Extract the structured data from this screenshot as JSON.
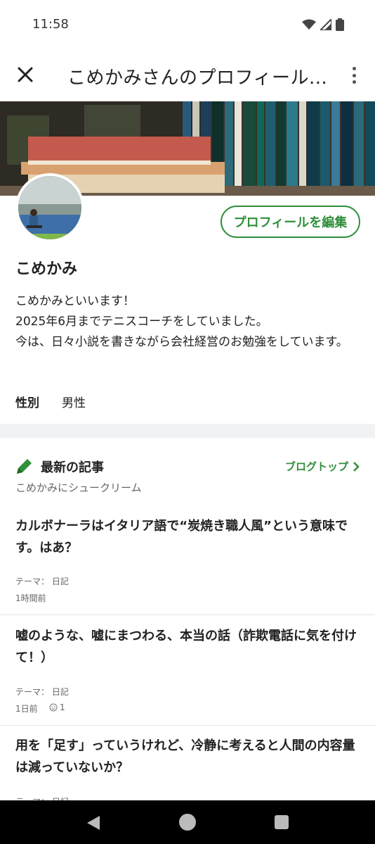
{
  "status": {
    "time": "11:58"
  },
  "header": {
    "title": "こめかみさんのプロフィール..."
  },
  "profile": {
    "edit_label": "プロフィールを編集",
    "name": "こめかみ",
    "bio_lines": [
      "こめかみといいます！",
      "2025年6月までテニスコーチをしていました。",
      "今は、日々小説を書きながら会社経営のお勉強をしています。"
    ],
    "gender_label": "性別",
    "gender_value": "男性"
  },
  "blog": {
    "section_title": "最新の記事",
    "top_link": "ブログトップ",
    "blog_name": "こめかみにシュークリーム",
    "articles": [
      {
        "title": "カルボナーラはイタリア語で“炭焼き職人風”という意味です。はあ？",
        "theme": "テーマ： 日記",
        "time": "1時間前",
        "likes": ""
      },
      {
        "title": "嘘のような、嘘にまつわる、本当の話（詐欺電話に気を付けて！）",
        "theme": "テーマ： 日記",
        "time": "1日前",
        "likes": "1"
      },
      {
        "title": "用を「足す」っていうけれど、冷静に考えると人間の内容量は減っていないか？",
        "theme": "テーマ： 日記",
        "time": "",
        "likes": ""
      }
    ]
  },
  "colors": {
    "accent": "#2f8f3a",
    "divider": "#f1f2f3",
    "nav": "#000000"
  },
  "icons": [
    "wifi-icon",
    "signal-icon",
    "battery-icon",
    "close-icon",
    "more-vert-icon",
    "pencil-icon",
    "chevron-right-icon",
    "smile-icon",
    "back-icon",
    "home-icon",
    "recents-icon"
  ]
}
